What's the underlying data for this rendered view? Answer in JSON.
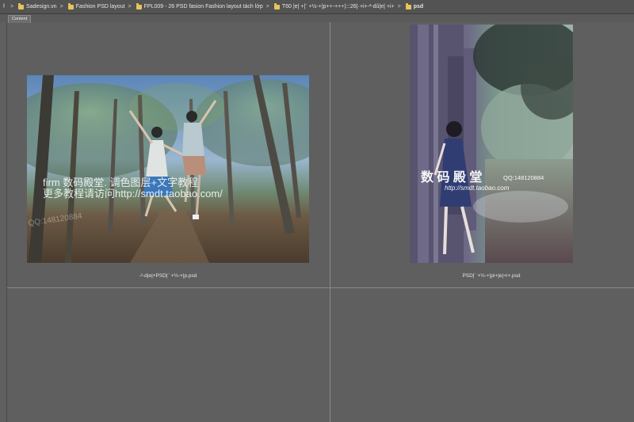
{
  "breadcrumb": {
    "lead": "f",
    "items": [
      {
        "label": "Sadesign.vn"
      },
      {
        "label": "Fashion PSD layout"
      },
      {
        "label": "FPL009 - 26 PSD fasion Fashion layout tách lớp"
      },
      {
        "label": "T60 |e| +|¨ +½-+|p++-+++|:::26|·+i+-²-dû|e| +i+"
      },
      {
        "label": "psd"
      }
    ]
  },
  "tab": {
    "label": "Content"
  },
  "files": [
    {
      "name": "-²-d|e|+PSD|¨ +½-+|p.psd",
      "watermark_line1": "firm 数码殿堂. 调色图层+文字教程",
      "watermark_line2": "更多教程请访问http://smdt.taobao.com/",
      "watermark_side": "QQ:148120884"
    },
    {
      "name": "PSD|¨ +½-+|pi+|e|+i+.psd",
      "watermark_title": "数 码 殿 堂",
      "watermark_qq": "QQ:148120884",
      "watermark_url": "http://smdt.taobao.com"
    }
  ],
  "colors": {
    "background": "#5f5f5f",
    "folder": "#e8c45a",
    "grid_line": "#8a8a8a"
  }
}
